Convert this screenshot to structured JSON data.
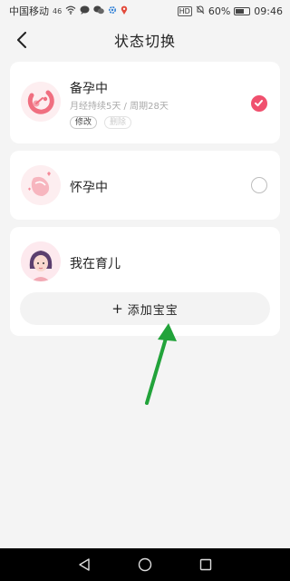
{
  "status_bar": {
    "carrier": "中国移动",
    "signal": "46",
    "battery": "60%",
    "time": "09:46",
    "hd": "HD"
  },
  "header": {
    "title": "状态切换"
  },
  "states": [
    {
      "title": "备孕中",
      "subtitle": "月经持续5天 / 周期28天",
      "edit_label": "修改",
      "delete_label": "删除",
      "selected": true
    },
    {
      "title": "怀孕中",
      "selected": false
    },
    {
      "title": "我在育儿",
      "add_baby_label": "添加宝宝",
      "add_icon": "plus-icon"
    }
  ],
  "colors": {
    "accent": "#f0506e",
    "arrow": "#22a33a",
    "background": "#f4f4f4"
  }
}
